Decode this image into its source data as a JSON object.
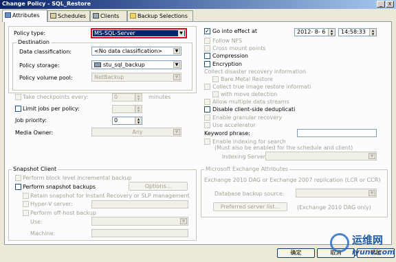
{
  "window": {
    "title": "Change Policy - SQL_Restore",
    "min_icon": "minimize-icon",
    "close_label": "X"
  },
  "tabs": [
    {
      "label": "Attributes",
      "icon": "attributes-icon"
    },
    {
      "label": "Schedules",
      "icon": "schedules-icon"
    },
    {
      "label": "Clients",
      "icon": "clients-icon"
    },
    {
      "label": "Backup Selections",
      "icon": "folder-icon"
    }
  ],
  "left": {
    "policy_type_label": "Policy type:",
    "policy_type_value": "MS-SQL-Server",
    "destination_title": "Destination",
    "data_classification_label": "Data classification:",
    "data_classification_value": "<No data classification>",
    "policy_storage_label": "Policy storage:",
    "policy_storage_value": "stu_sql_backup",
    "policy_volume_pool_label": "Policy volume pool:",
    "policy_volume_pool_value": "NetBackup",
    "take_checkpoints_label": "Take checkpoints every:",
    "take_checkpoints_value": "0",
    "minutes_label": "minutes",
    "limit_jobs_label": "Limit jobs per policy:",
    "limit_jobs_value": "",
    "job_priority_label": "Job priority:",
    "job_priority_value": "0",
    "media_owner_label": "Media Owner:",
    "media_owner_value": "Any"
  },
  "snapshot": {
    "title": "Snapshot Client",
    "block_level_label": "Perform block level incremental backup",
    "perform_snapshot_label": "Perform snapshot backups",
    "options_label": "Options...",
    "retain_label": "Retain snapshot for Instant Recovery or SLP management",
    "hyperv_label": "Hyper-V server:",
    "offhost_label": "Perform off-host backup",
    "use_label": "Use:",
    "machine_label": "Machine:"
  },
  "right": {
    "go_into_effect_label": "Go into effect at",
    "date_value": "2012- 8- 6",
    "time_value": "14:58:33",
    "follow_nfs_label": "Follow NFS",
    "cross_mount_label": "Cross mount points",
    "compression_label": "Compression",
    "encryption_label": "Encryption",
    "collect_disaster_label": "Collect disaster recovery information",
    "bare_metal_label": "Bare Metal Restore",
    "collect_true_image_label": "Collect true image restore informati",
    "with_move_label": "with move detection",
    "allow_multiple_label": "Allow multiple data streams",
    "disable_dedup_label": "Disable client-side deduplicati",
    "enable_granular_label": "Enable granular recovery",
    "use_accelerator_label": "Use accelerator",
    "keyword_label": "Keyword phrase:",
    "keyword_value": "",
    "enable_indexing_label": "Enable indexing for search",
    "indexing_note": "(Must also be enabled for the schedule and client)",
    "indexing_server_label": "Indexing Server:"
  },
  "exchange": {
    "title": "Microsoft Exchange Attributes",
    "dag_label": "Exchange 2010 DAG or Exchange 2007 replication (LCR or CCR)",
    "db_source_label": "Database backup source:",
    "preferred_label": "Preferred server list...",
    "dag_only_label": "(Exchange 2010 DAG only)"
  },
  "footer": {
    "ok_label": "确定",
    "cancel_label": "取消",
    "help_label": "帮助"
  },
  "watermark": {
    "line1": "运维网",
    "line2": "iyunv.com"
  },
  "colors": {
    "title_bar": "#0a246a",
    "selection_red": "#e0001b",
    "panel_bg": "#fcfcfe",
    "dialog_bg": "#ece9d8"
  }
}
